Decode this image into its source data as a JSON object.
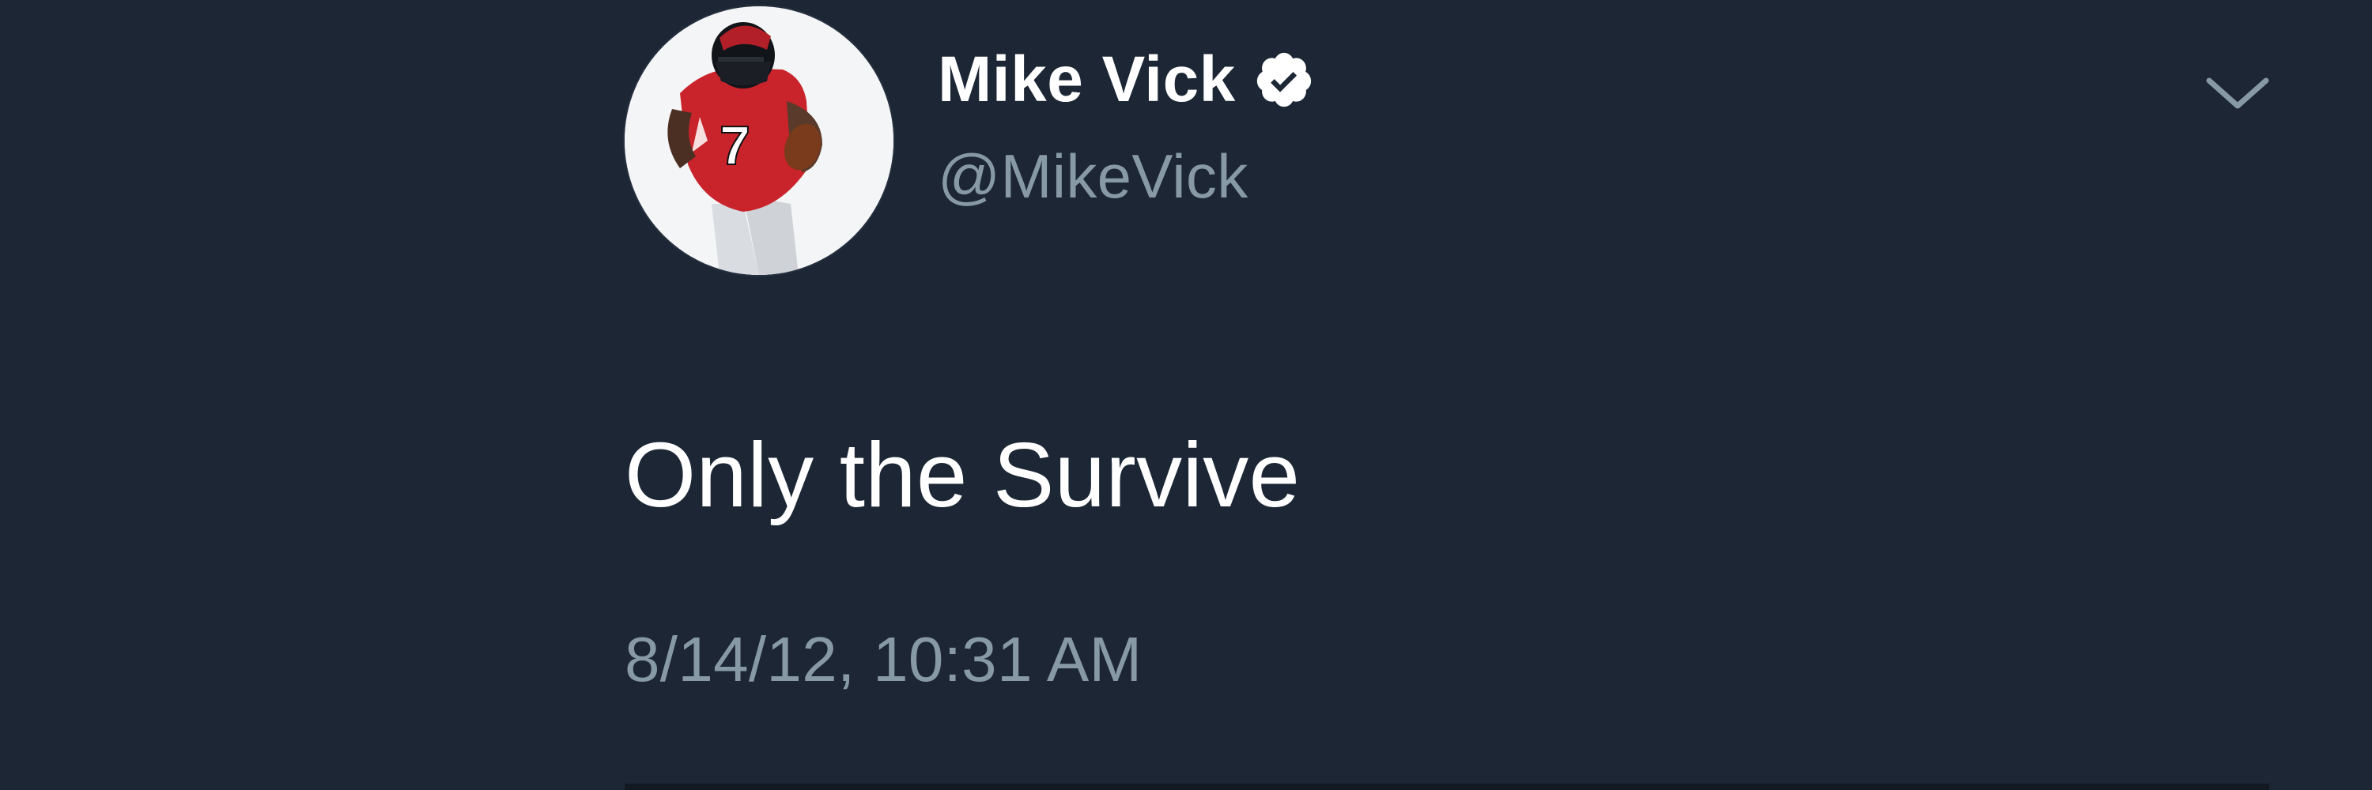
{
  "tweet": {
    "display_name": "Mike Vick",
    "handle": "@MikeVick",
    "text": "Only the Survive",
    "timestamp": "8/14/12, 10:31 AM",
    "verified": true
  },
  "icons": {
    "verified": "verified-badge-icon",
    "more": "chevron-down-icon",
    "avatar": "profile-photo"
  },
  "colors": {
    "background": "#1c2635",
    "primary_text": "#ffffff",
    "secondary_text": "#8899a6"
  }
}
